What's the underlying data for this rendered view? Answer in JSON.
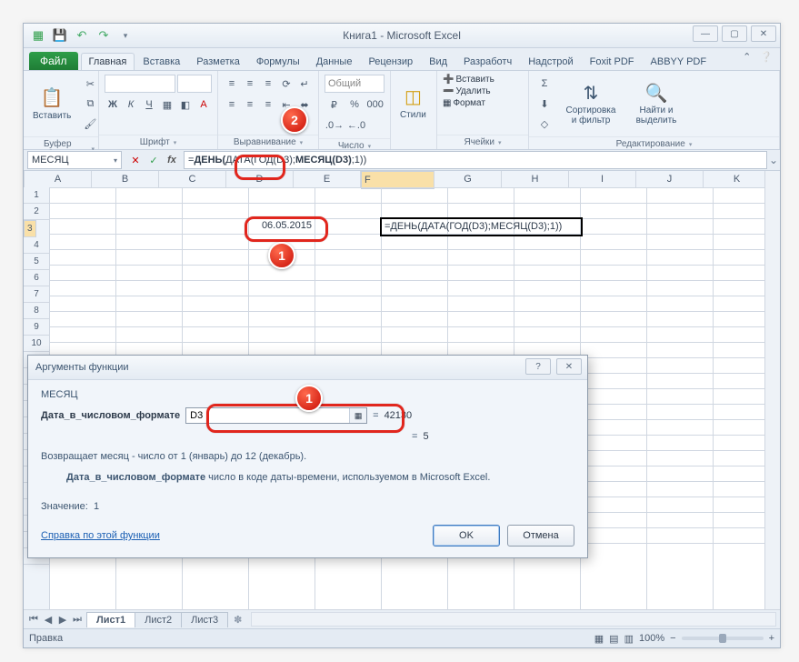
{
  "window": {
    "title": "Книга1 - Microsoft Excel"
  },
  "tabs": {
    "file": "Файл",
    "items": [
      "Главная",
      "Вставка",
      "Разметка",
      "Формулы",
      "Данные",
      "Рецензир",
      "Вид",
      "Разработч",
      "Надстрой",
      "Foxit PDF",
      "ABBYY PDF"
    ],
    "active": 0
  },
  "ribbon": {
    "clipboard": {
      "paste": "Вставить",
      "label": "Буфер обмена"
    },
    "font": {
      "label": "Шрифт",
      "bold": "Ж",
      "italic": "К",
      "underline": "Ч"
    },
    "alignment": {
      "label": "Выравнивание"
    },
    "number": {
      "format_selected": "Общий",
      "label": "Число"
    },
    "styles": {
      "btn": "Стили",
      "label": "."
    },
    "cells": {
      "insert": "Вставить",
      "delete": "Удалить",
      "format": "Формат",
      "label": "Ячейки"
    },
    "editing": {
      "sort": "Сортировка и фильтр",
      "find": "Найти и выделить",
      "label": "Редактирование"
    }
  },
  "formula_bar": {
    "name_box": "МЕСЯЦ",
    "formula_html": "=<b>ДЕНЬ(</b>ДАТА(ГОД(D3);<b>МЕСЯЦ(D3)</b>;1))"
  },
  "grid": {
    "columns": [
      "A",
      "B",
      "C",
      "D",
      "E",
      "F",
      "G",
      "H",
      "I",
      "J",
      "K"
    ],
    "row_count": 23,
    "selected_col_idx": 5,
    "selected_row": 3,
    "cells": {
      "D3": "06.05.2015",
      "F3": "=ДЕНЬ(ДАТА(ГОД(D3);МЕСЯЦ(D3);1))"
    }
  },
  "sheets": {
    "items": [
      "Лист1",
      "Лист2",
      "Лист3"
    ],
    "active": 0
  },
  "status": {
    "mode": "Правка",
    "zoom": "100%"
  },
  "dialog": {
    "title": "Аргументы функции",
    "func": "МЕСЯЦ",
    "arg_label": "Дата_в_числовом_формате",
    "arg_value": "D3",
    "arg_eval": "42130",
    "func_eval": "5",
    "desc": "Возвращает месяц - число от 1 (январь) до 12 (декабрь).",
    "arg_desc_label": "Дата_в_числовом_формате",
    "arg_desc": " число в коде даты-времени, используемом в Microsoft Excel.",
    "result_label": "Значение:",
    "result_value": "1",
    "help": "Справка по этой функции",
    "ok": "OK",
    "cancel": "Отмена"
  },
  "annotations": {
    "badge1a": "1",
    "badge2": "2",
    "badge1b": "1"
  }
}
